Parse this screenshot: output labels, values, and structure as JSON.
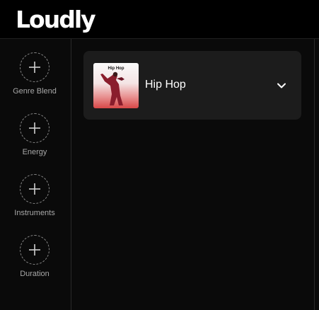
{
  "app": {
    "logo": "Loudly"
  },
  "sidebar": {
    "items": [
      {
        "label": "Genre Blend",
        "icon": "plus-icon"
      },
      {
        "label": "Energy",
        "icon": "plus-icon"
      },
      {
        "label": "Instruments",
        "icon": "plus-icon"
      },
      {
        "label": "Duration",
        "icon": "plus-icon"
      }
    ]
  },
  "main": {
    "genre_card": {
      "name": "Hip Hop",
      "cover_title": "Hip Hop",
      "expand_icon": "chevron-down-icon"
    }
  },
  "colors": {
    "background": "#0a0a0a",
    "topbar": "#000000",
    "card": "#1c1c1c",
    "text": "#ffffff",
    "label": "#a8a8a8"
  }
}
